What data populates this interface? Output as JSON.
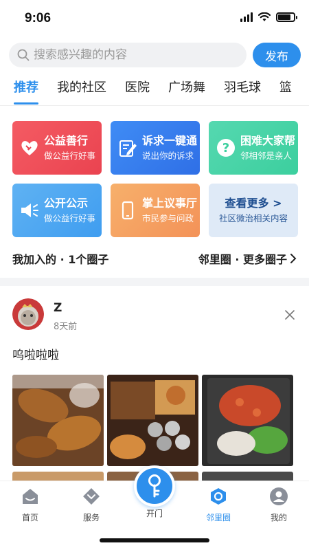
{
  "status": {
    "time": "9:06"
  },
  "search": {
    "placeholder": "搜索感兴趣的内容",
    "publish_label": "发布"
  },
  "tabs": [
    {
      "label": "推荐",
      "active": true
    },
    {
      "label": "我的社区"
    },
    {
      "label": "医院"
    },
    {
      "label": "广场舞"
    },
    {
      "label": "羽毛球"
    },
    {
      "label": "篮"
    }
  ],
  "services": [
    {
      "title": "公益善行",
      "subtitle": "做公益行好事",
      "icon": "heart-hand-icon"
    },
    {
      "title": "诉求一键通",
      "subtitle": "说出你的诉求",
      "icon": "edit-form-icon"
    },
    {
      "title": "困难大家帮",
      "subtitle": "邻相邻是亲人",
      "icon": "question-icon"
    },
    {
      "title": "公开公示",
      "subtitle": "做公益行好事",
      "icon": "megaphone-icon"
    },
    {
      "title": "掌上议事厅",
      "subtitle": "市民参与问政",
      "icon": "phone-icon"
    },
    {
      "title": "查看更多 >",
      "subtitle": "社区微治相关内容"
    }
  ],
  "circles": {
    "joined": "我加入的 · 1个圈子",
    "more": "邻里圈 · 更多圈子"
  },
  "post": {
    "author": "Z",
    "time": "8天前",
    "text": "呜啦啦啦"
  },
  "tabbar": [
    {
      "label": "首页",
      "icon": "home-icon"
    },
    {
      "label": "服务",
      "icon": "service-diamond-icon"
    },
    {
      "label": "开门",
      "icon": "key-icon"
    },
    {
      "label": "邻里圈",
      "icon": "neighborhood-icon",
      "active": true
    },
    {
      "label": "我的",
      "icon": "profile-icon"
    }
  ],
  "colors": {
    "accent": "#2d8fec",
    "red": "#ea4350",
    "blue": "#2f6fe6",
    "green": "#3ccf9e",
    "orange": "#f39258"
  }
}
